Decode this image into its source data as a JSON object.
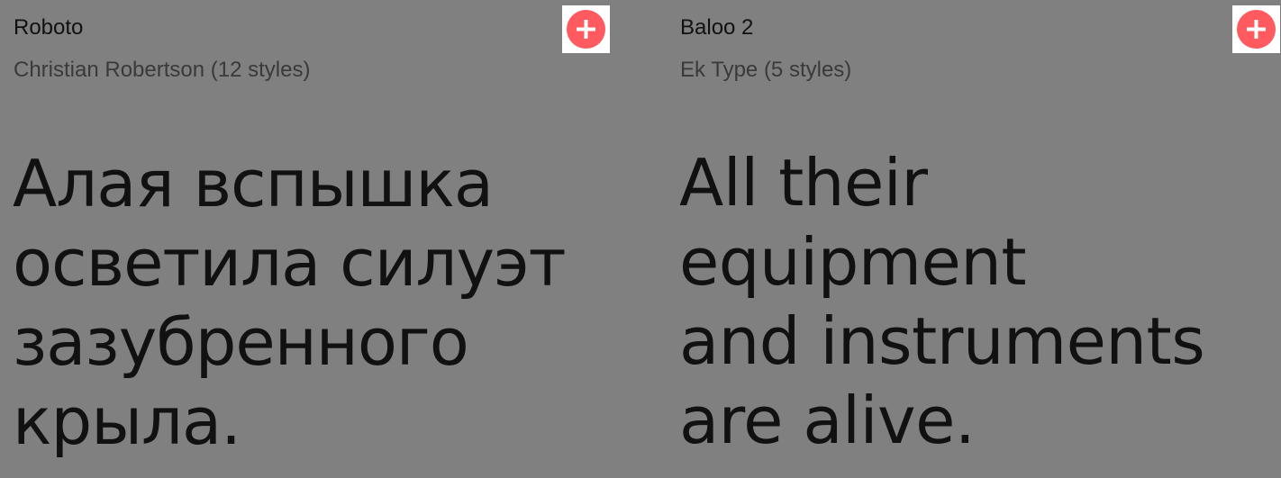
{
  "colors": {
    "background": "#808080",
    "add_button_bg": "#ffffff",
    "add_button_accent": "#ff5a5f",
    "sample_text": "#111111",
    "meta_text": "#3a3a3a"
  },
  "cards": [
    {
      "font_name": "Roboto",
      "meta": "Christian Robertson (12 styles)",
      "add_icon": "plus-circle-icon",
      "sample_lines": [
        "Алая вспышка",
        "осветила силуэт",
        "зазубренного",
        "крыла."
      ]
    },
    {
      "font_name": "Baloo 2",
      "meta": "Ek Type (5 styles)",
      "add_icon": "plus-circle-icon",
      "sample_lines": [
        "All their equipment",
        "and instruments",
        "are alive."
      ]
    }
  ]
}
